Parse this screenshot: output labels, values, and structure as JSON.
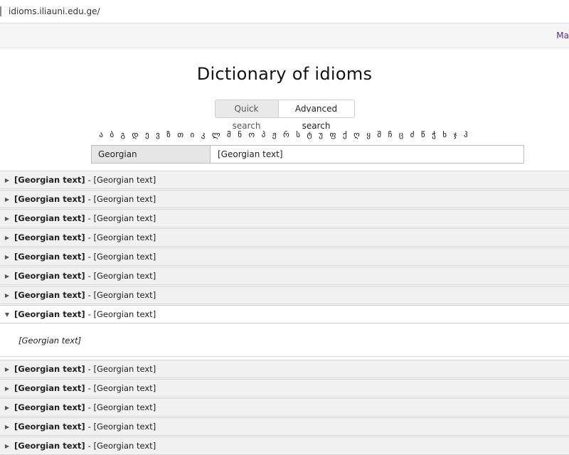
{
  "browser": {
    "url": "idioms.iliauni.edu.ge/"
  },
  "topbar": {
    "menu_label": "Ma"
  },
  "page": {
    "title": "Dictionary of idioms"
  },
  "tabs": [
    {
      "label": "Quick search",
      "active": false
    },
    {
      "label": "Advanced search",
      "active": true
    }
  ],
  "alphabet": "ა ბ გ დ ე ვ ზ თ ი კ ლ მ ნ ო პ ჟ რ ს ტ უ ფ ქ ღ ყ შ ჩ ც ძ წ ჭ ხ ჯ ჰ",
  "search": {
    "language": "Georgian",
    "query": "[Georgian text]"
  },
  "results": [
    {
      "head": "[Georgian text]",
      "def": "- [Georgian text]"
    },
    {
      "head": "[Georgian text]",
      "def": "- [Georgian text]"
    },
    {
      "head": "[Georgian text]",
      "def": "- [Georgian text]"
    },
    {
      "head": "[Georgian text]",
      "def": "- [Georgian text]"
    },
    {
      "head": "[Georgian text]",
      "def": "- [Georgian text]"
    },
    {
      "head": "[Georgian text]",
      "def": "- [Georgian text]"
    },
    {
      "head": "[Georgian text]",
      "def": "- [Georgian text]"
    },
    {
      "head": "[Georgian text]",
      "def": "- [Georgian text]",
      "example": "[Georgian text]"
    },
    {
      "head": "[Georgian text]",
      "def": "- [Georgian text]"
    },
    {
      "head": "[Georgian text]",
      "def": "- [Georgian text]"
    },
    {
      "head": "[Georgian text]",
      "def": "- [Georgian text]"
    },
    {
      "head": "[Georgian text]",
      "def": "- [Georgian text]"
    },
    {
      "head": "[Georgian text]",
      "def": "- [Georgian text]"
    }
  ]
}
